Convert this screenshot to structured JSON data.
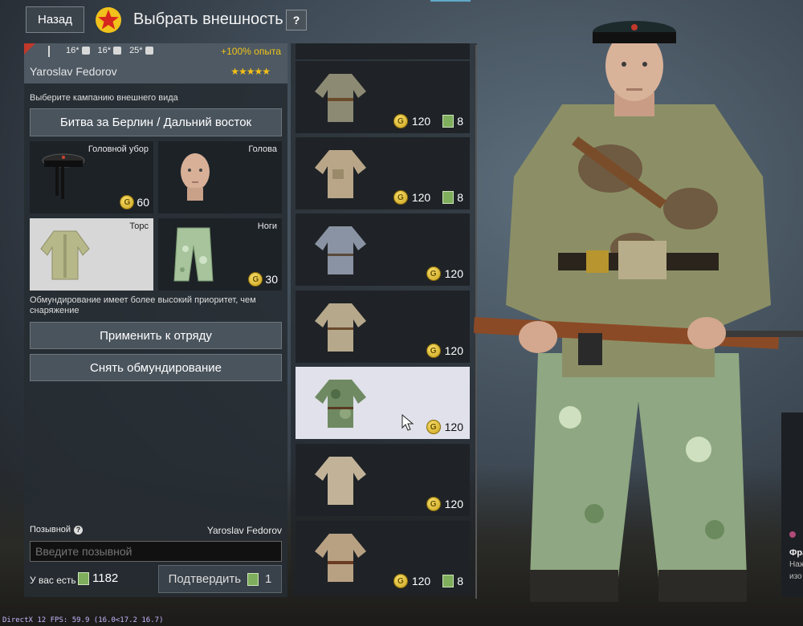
{
  "header": {
    "back_label": "Назад",
    "title": "Выбрать внешность",
    "help_label": "?"
  },
  "soldier": {
    "stats": [
      "16*",
      "16*",
      "25*"
    ],
    "exp_bonus": "+100% опыта",
    "name": "Yaroslav Fedorov",
    "rating": "★★★★★"
  },
  "campaign": {
    "label": "Выберите кампанию внешнего вида",
    "selected": "Битва за Берлин / Дальний восток"
  },
  "slots": [
    {
      "label": "Головной убор",
      "price": "60"
    },
    {
      "label": "Голова",
      "price": ""
    },
    {
      "label": "Торс",
      "price": ""
    },
    {
      "label": "Ноги",
      "price": "30"
    }
  ],
  "priority_note": "Обмундирование имеет более высокий приоритет, чем снаряжение",
  "actions": {
    "apply": "Применить к отряду",
    "remove": "Снять обмундирование"
  },
  "callsign": {
    "label": "Позывной",
    "name": "Yaroslav Fedorov",
    "placeholder": "Введите позывной"
  },
  "wallet": {
    "label": "У вас есть",
    "tickets": "1182",
    "confirm": "Подтвердить",
    "confirm_cost": "1"
  },
  "items": [
    {
      "gold": "120",
      "tickets": "8"
    },
    {
      "gold": "120",
      "tickets": "8"
    },
    {
      "gold": "120",
      "tickets": ""
    },
    {
      "gold": "120",
      "tickets": ""
    },
    {
      "gold": "120",
      "tickets": ""
    },
    {
      "gold": "120",
      "tickets": ""
    },
    {
      "gold": "120",
      "tickets": "8"
    }
  ],
  "notice": {
    "title": "Фра",
    "line1": "Наж",
    "line2": "изо"
  },
  "fps_text": "DirectX 12 FPS: 59.9 (16.0<17.2 16.7)",
  "colors": {
    "accent_gold": "#f0c419",
    "panel": "#262c32",
    "button": "#4a545d",
    "selected_item": "#e0e1ea"
  }
}
